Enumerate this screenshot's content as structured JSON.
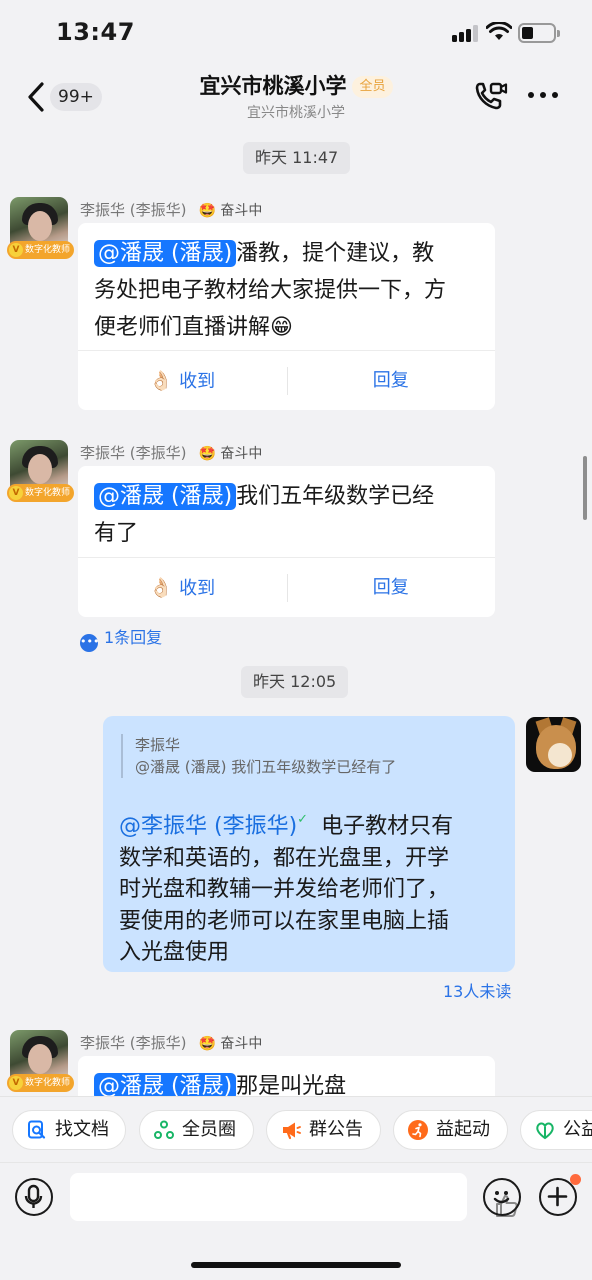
{
  "status_bar": {
    "time": "13:47"
  },
  "header": {
    "back_count": "99+",
    "title": "宜兴市桃溪小学",
    "tag": "全员",
    "subtitle": "宜兴市桃溪小学",
    "icons": [
      "chevron-left-icon",
      "video-call-icon",
      "more-icon"
    ]
  },
  "messages": [
    {
      "type": "timestamp",
      "text": "昨天 11:47"
    },
    {
      "type": "incoming",
      "sender": "李振华 (李振华)",
      "status": "🤩 奋斗中",
      "badge": "数字化教师",
      "mention": "@潘晟 (潘晟)",
      "lines": [
        "潘教，提个建议，教",
        "务处把电子教材给大家提供一下，方",
        "便老师们直播讲解😁"
      ],
      "action_ack": "收到",
      "action_reply": "回复"
    },
    {
      "type": "incoming",
      "sender": "李振华 (李振华)",
      "status": "🤩 奋斗中",
      "badge": "数字化教师",
      "mention": "@潘晟 (潘晟)",
      "lines": [
        "我们五年级数学已经",
        "有了"
      ],
      "action_ack": "收到",
      "action_reply": "回复",
      "reply_count": "1条回复"
    },
    {
      "type": "timestamp",
      "text": "昨天 12:05"
    },
    {
      "type": "outgoing",
      "quote_author": "李振华",
      "quote_text": "@潘晟 (潘晟) 我们五年级数学已经有了",
      "mention": "@李振华 (李振华)",
      "lines": [
        " 电子教材只有",
        "数学和英语的，都在光盘里，开学",
        "时光盘和教辅一并发给老师们了，",
        "要使用的老师可以在家里电脑上插",
        "入光盘使用"
      ],
      "read_status": "13人未读"
    },
    {
      "type": "incoming",
      "sender": "李振华 (李振华)",
      "status": "🤩 奋斗中",
      "badge": "数字化教师",
      "mention": "@潘晟 (潘晟)",
      "lines": [
        "那是叫光盘"
      ]
    }
  ],
  "quick_bar": [
    {
      "label": "找文档",
      "icon": "doc-search-icon",
      "color": "#1677ff"
    },
    {
      "label": "全员圈",
      "icon": "circle-icon",
      "color": "#18b566"
    },
    {
      "label": "群公告",
      "icon": "megaphone-icon",
      "color": "#ff6a1a"
    },
    {
      "label": "益起动",
      "icon": "run-icon",
      "color": "#ff6a1a"
    },
    {
      "label": "公益",
      "icon": "charity-icon",
      "color": "#18b566"
    }
  ],
  "input_bar": {
    "placeholder": ""
  },
  "colors": {
    "accent": "#1677ff",
    "bubble_out": "#cbe3ff",
    "badge": "#f3a52c"
  }
}
